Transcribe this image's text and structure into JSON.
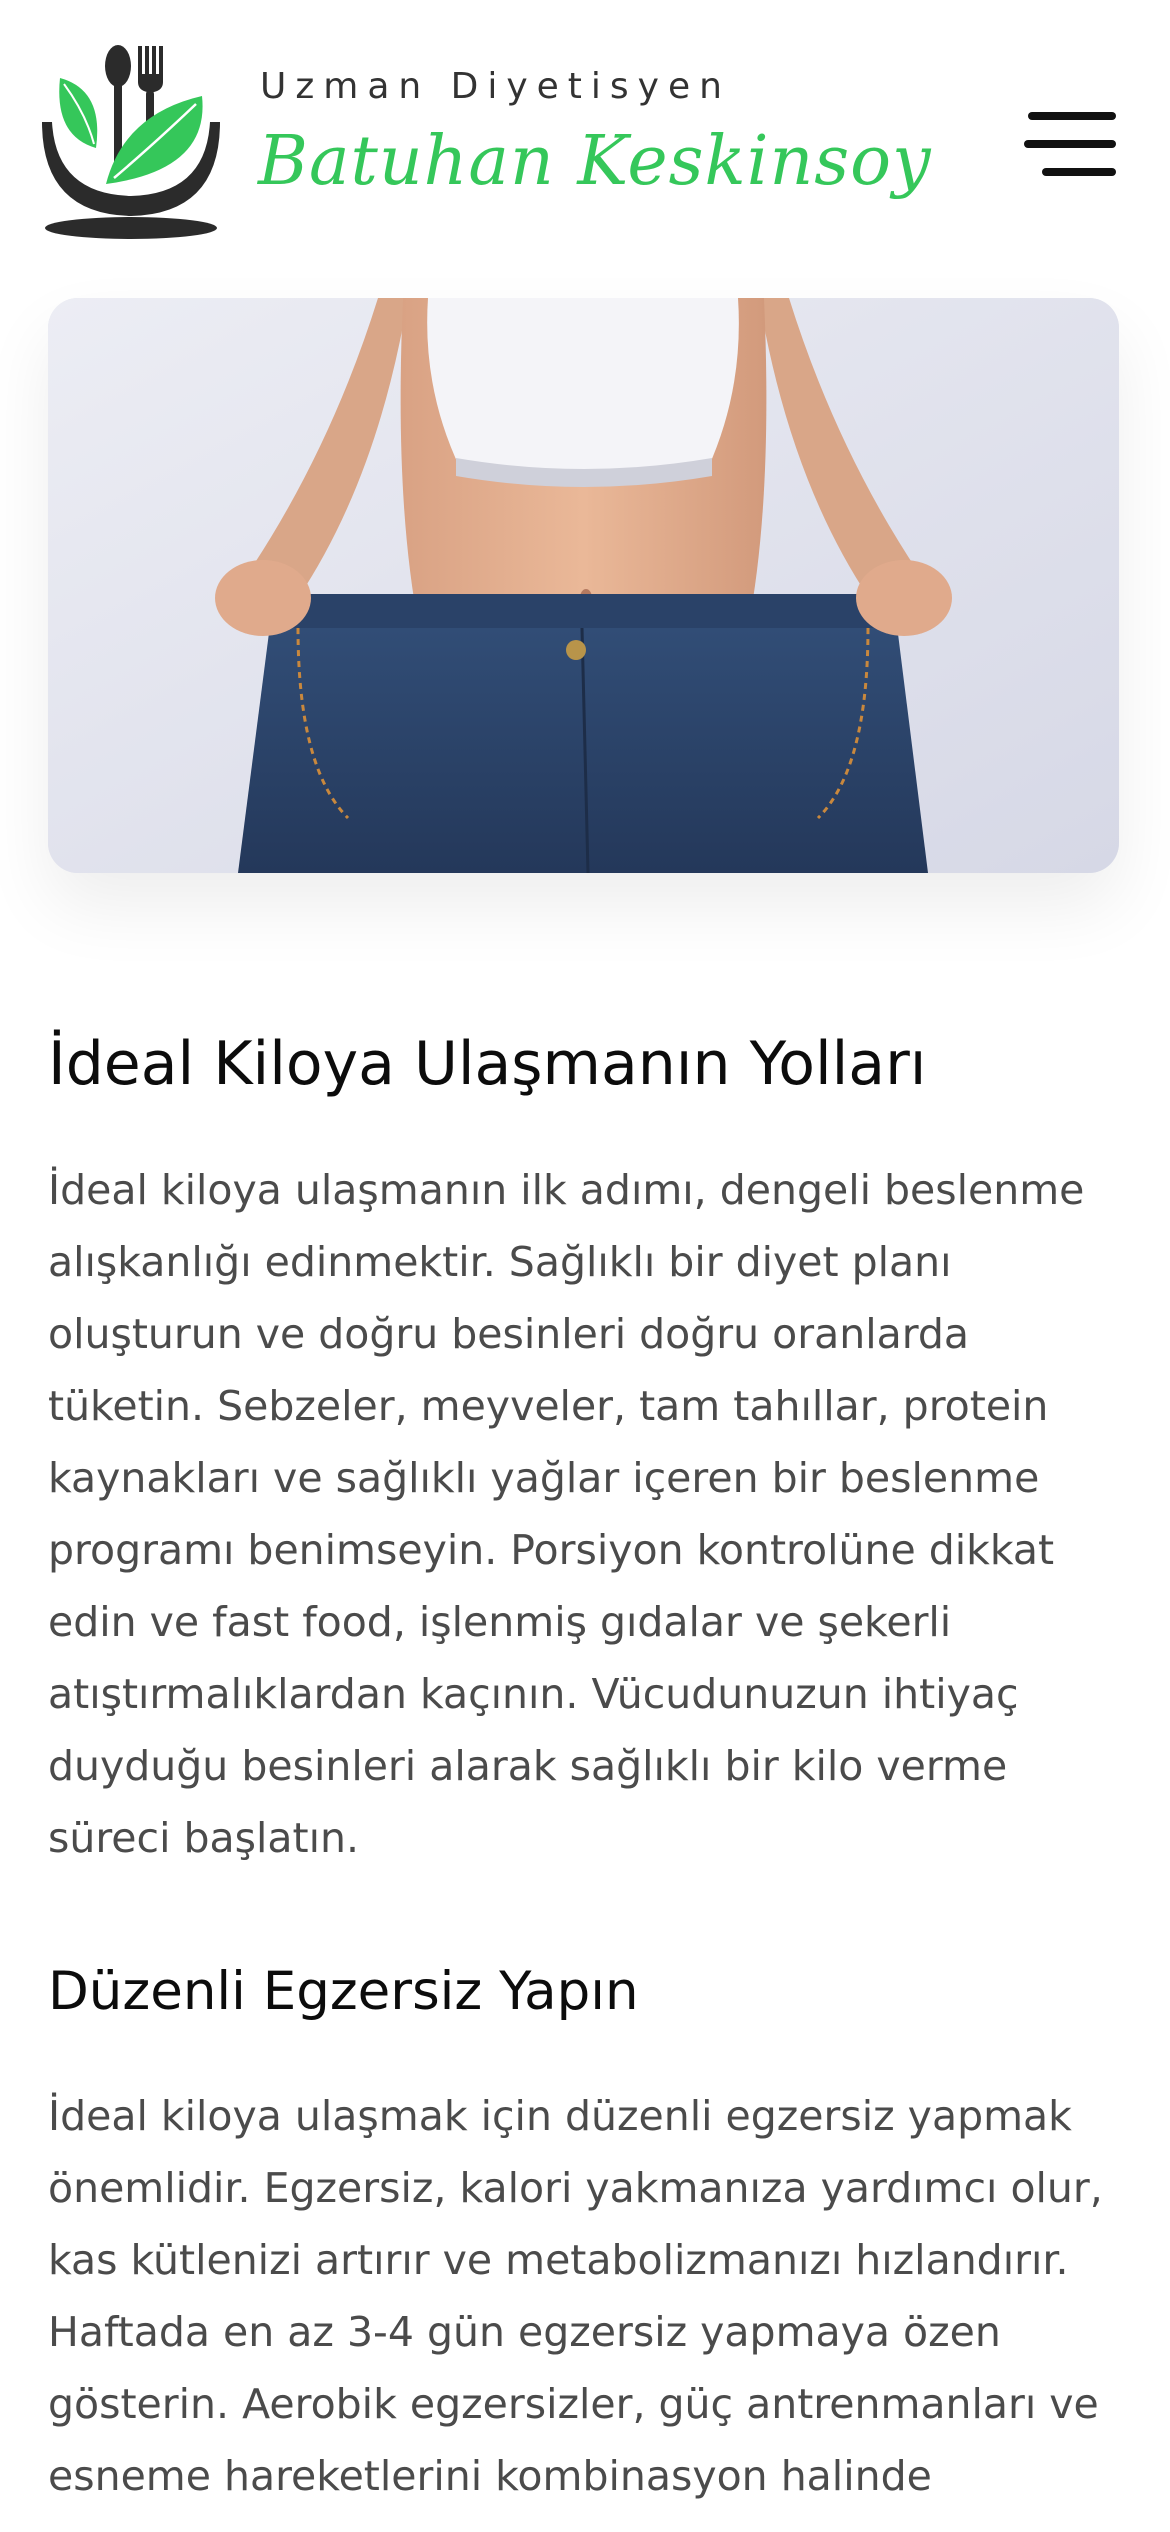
{
  "header": {
    "subtitle": "Uzman Diyetisyen",
    "name": "Batuhan Keskinsoy",
    "accent_color": "#35c75a",
    "logo_icon": "plate-fork-spoon-leaf-icon",
    "menu_icon": "hamburger-menu-icon"
  },
  "hero": {
    "image_description": "woman-wearing-oversized-jeans-weight-loss"
  },
  "article": {
    "title": "İdeal Kiloya Ulaşmanın Yolları",
    "paragraph1": "İdeal kiloya ulaşmanın ilk adımı, dengeli beslenme alışkanlığı edinmektir. Sağlıklı bir diyet planı oluşturun ve doğru besinleri doğru oranlarda tüketin. Sebzeler, meyveler, tam tahıllar, protein kaynakları ve sağlıklı yağlar içeren bir beslenme programı benimseyin. Porsiyon kontrolüne dikkat edin ve fast food, işlenmiş gıdalar ve şekerli atıştırmalıklardan kaçının. Vücudunuzun ihtiyaç duyduğu besinleri alarak sağlıklı bir kilo verme süreci başlatın.",
    "section_title": "Düzenli Egzersiz Yapın",
    "paragraph2": "İdeal kiloya ulaşmak için düzenli egzersiz yapmak önemlidir. Egzersiz, kalori yakmanıza yardımcı olur, kas kütlenizi artırır ve metabolizmanızı hızlandırır. Haftada en az 3-4 gün egzersiz yapmaya özen gösterin. Aerobik egzersizler, güç antrenmanları ve esneme hareketlerini kombinasyon halinde"
  }
}
